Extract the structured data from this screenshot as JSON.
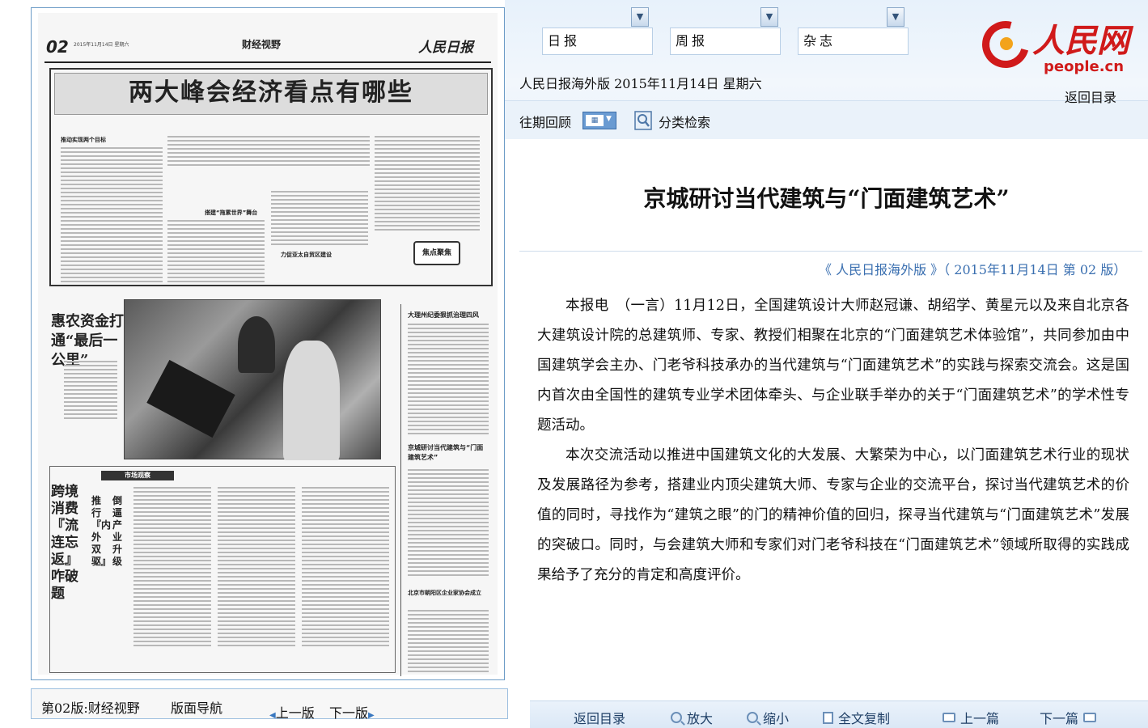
{
  "paper": {
    "page_num": "02",
    "date_line": "2015年11月14日  星期六",
    "section": "财经视野",
    "masthead": "人民日报",
    "lead_title": "两大峰会经济看点有哪些",
    "lead_subheads": [
      "推动实现两个目标",
      "搭建“拖累世界”舞台",
      "力促亚太自贸区建设"
    ],
    "stamp": "焦点聚焦",
    "farm_headline": "惠农资金打通“最后一公里”",
    "side_titles": [
      "大理州纪委狠抓治理四风",
      "京城研讨当代建筑与“门面建筑艺术”",
      "北京市朝阳区企业家协会成立"
    ],
    "market_label": "市场观察",
    "cross_headline": "跨境消费『流连忘返』咋破题",
    "cross_sub1": "推行『内外双驱』",
    "cross_sub2": "倒逼产业升级",
    "footer_label": "第02版:财经视野",
    "footer_nav": "版面导航",
    "prev_page": "上一版",
    "next_page": "下一版"
  },
  "header": {
    "selectors": [
      "日报",
      "周报",
      "杂志"
    ],
    "edition_line": "人民日报海外版 2015年11月14日 星期六",
    "back_toc": "返回目录",
    "review_label": "往期回顾",
    "search_label": "分类检索",
    "logo_text": "人民网",
    "logo_url": "people.cn"
  },
  "article": {
    "title": "京城研讨当代建筑与“门面建筑艺术”",
    "source": "《 人民日报海外版 》（ 2015年11月14日   第 02 版）",
    "paragraphs": [
      "本报电　（一言）11月12日，全国建筑设计大师赵冠谦、胡绍学、黄星元以及来自北京各大建筑设计院的总建筑师、专家、教授们相聚在北京的“门面建筑艺术体验馆”，共同参加由中国建筑学会主办、门老爷科技承办的当代建筑与“门面建筑艺术”的实践与探索交流会。这是国内首次由全国性的建筑专业学术团体牵头、与企业联手举办的关于“门面建筑艺术”的学术性专题活动。",
      "本次交流活动以推进中国建筑文化的大发展、大繁荣为中心，以门面建筑艺术行业的现状及发展路径为参考，搭建业内顶尖建筑大师、专家与企业的交流平台，探讨当代建筑艺术的价值的同时，寻找作为“建筑之眼”的门的精神价值的回归，探寻当代建筑与“门面建筑艺术”发展的突破口。同时，与会建筑大师和专家们对门老爷科技在“门面建筑艺术”领域所取得的实践成果给予了充分的肯定和高度评价。"
    ]
  },
  "toolbar": {
    "back": "返回目录",
    "zoom_in": "放大",
    "zoom_out": "缩小",
    "copy": "全文复制",
    "prev": "上一篇",
    "next": "下一篇"
  },
  "colors": {
    "accent_blue": "#3a6fb0",
    "brand_red": "#d01a1a",
    "header_bg": "#e7f1fb"
  }
}
